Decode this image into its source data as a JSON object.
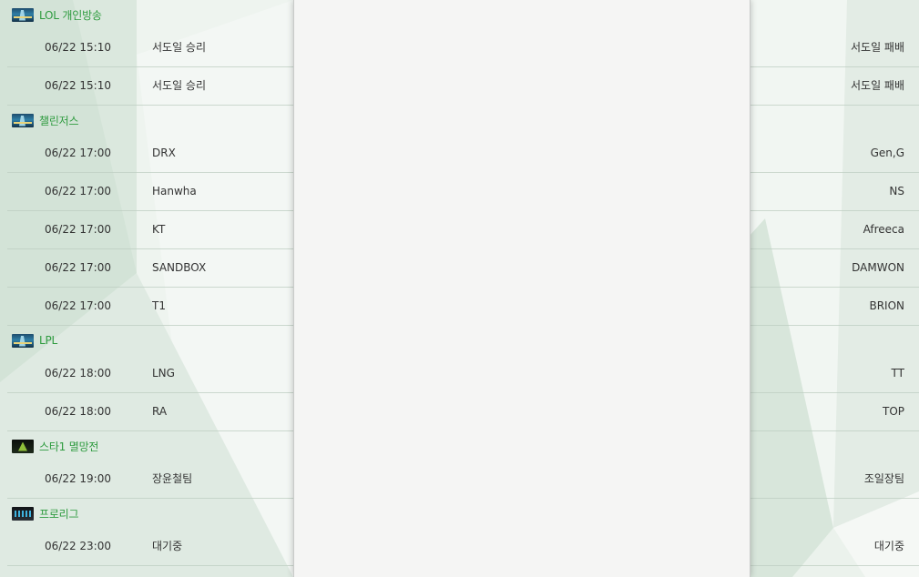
{
  "schedule": {
    "leagues": [
      {
        "name": "LOL 개인방송",
        "icon": "lol-icon",
        "matches": [
          {
            "time": "06/22 15:10",
            "home": "서도일 승리",
            "away": "서도일 패배"
          },
          {
            "time": "06/22 15:10",
            "home": "서도일 승리",
            "away": "서도일 패배"
          }
        ]
      },
      {
        "name": "챌린저스",
        "icon": "lol-icon",
        "matches": [
          {
            "time": "06/22 17:00",
            "home": "DRX",
            "away": "Gen,G"
          },
          {
            "time": "06/22 17:00",
            "home": "Hanwha",
            "away": "NS"
          },
          {
            "time": "06/22 17:00",
            "home": "KT",
            "away": "Afreeca"
          },
          {
            "time": "06/22 17:00",
            "home": "SANDBOX",
            "away": "DAMWON"
          },
          {
            "time": "06/22 17:00",
            "home": "T1",
            "away": "BRION"
          }
        ]
      },
      {
        "name": "LPL",
        "icon": "lol-icon",
        "matches": [
          {
            "time": "06/22 18:00",
            "home": "LNG",
            "away": "TT"
          },
          {
            "time": "06/22 18:00",
            "home": "RA",
            "away": "TOP"
          }
        ]
      },
      {
        "name": "스타1 멸망전",
        "icon": "starcraft-icon",
        "matches": [
          {
            "time": "06/22 19:00",
            "home": "장윤철팀",
            "away": "조일장팀"
          }
        ]
      },
      {
        "name": "프로리그",
        "icon": "proleague-icon",
        "matches": [
          {
            "time": "06/22 23:00",
            "home": "대기중",
            "away": "대기중"
          }
        ]
      }
    ]
  },
  "colors": {
    "league_name": "#2e9b3f",
    "text": "#333333",
    "panel": "#f5f5f4"
  }
}
